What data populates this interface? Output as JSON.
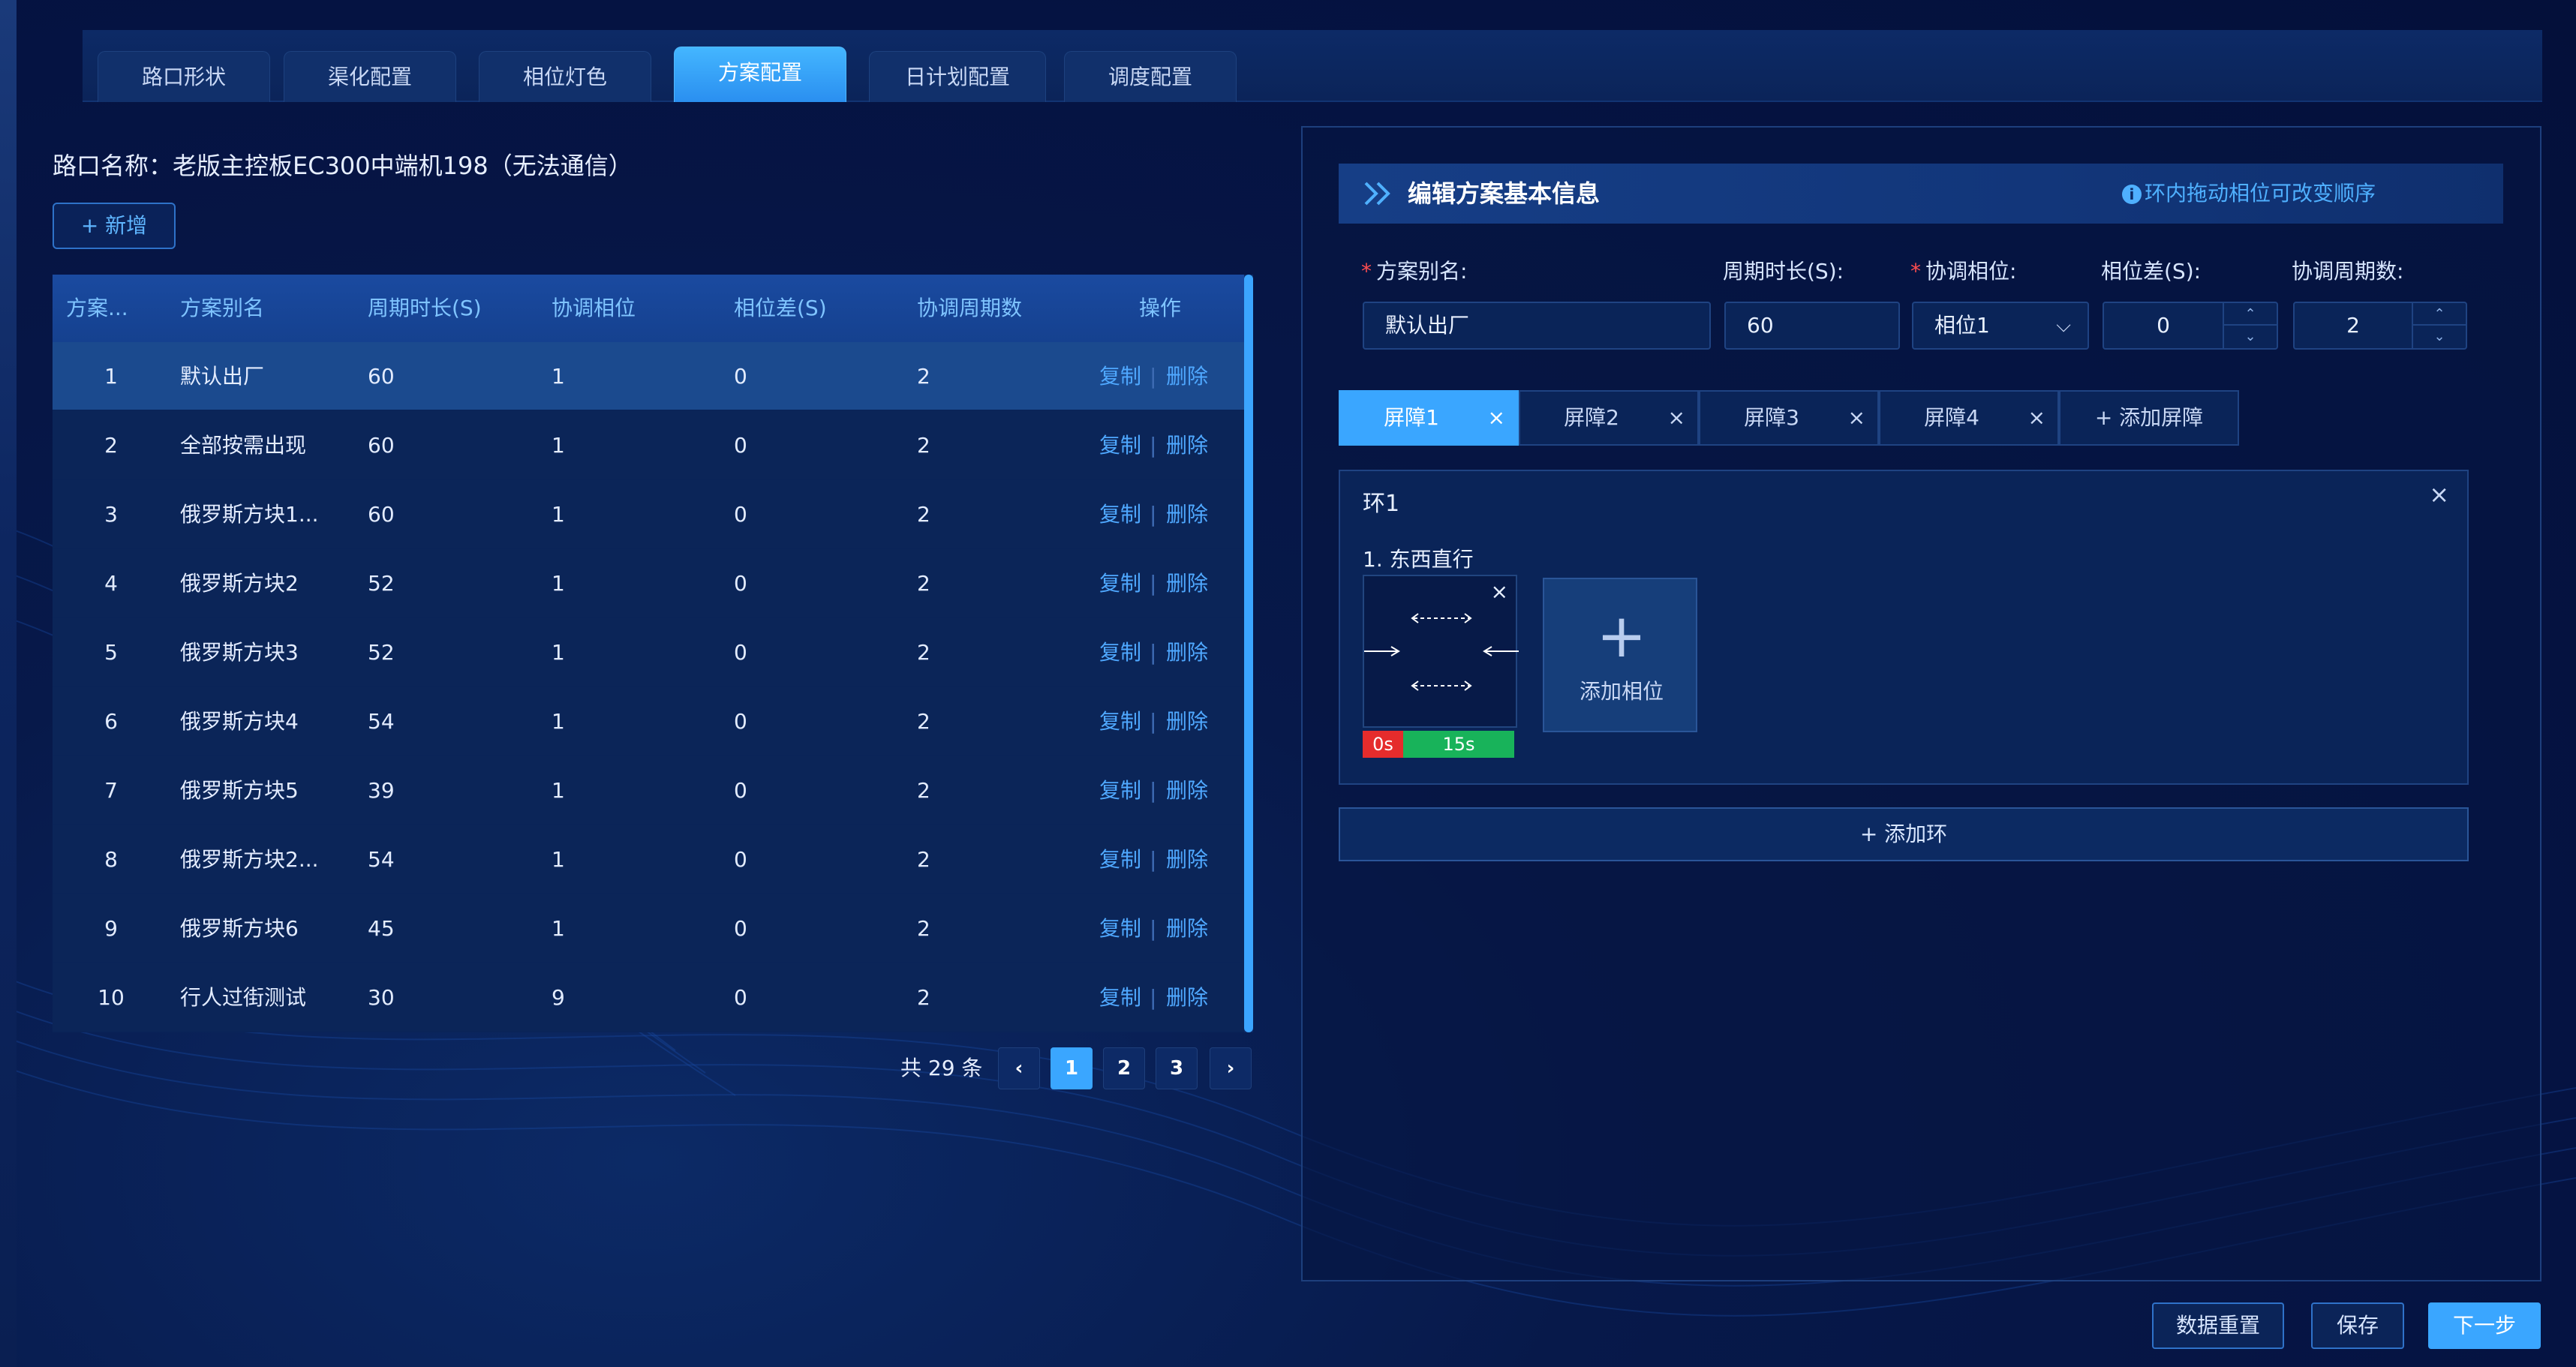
{
  "tabs": [
    {
      "label": "路口形状"
    },
    {
      "label": "渠化配置"
    },
    {
      "label": "相位灯色"
    },
    {
      "label": "方案配置"
    },
    {
      "label": "日计划配置"
    },
    {
      "label": "调度配置"
    }
  ],
  "active_tab": "方案配置",
  "intersection": {
    "title": "路口名称：老版主控板EC300中端机198（无法通信）"
  },
  "add_button": {
    "icon": "plus-icon",
    "label": "+ 新增"
  },
  "table": {
    "headers": [
      "方案...",
      "方案别名",
      "周期时长(S)",
      "协调相位",
      "相位差(S)",
      "协调周期数",
      "操作"
    ],
    "rows": [
      {
        "id": "1",
        "name": "默认出厂",
        "cycle": "60",
        "coord": "1",
        "offset": "0",
        "periods": "2",
        "copy": "复制",
        "sep": "|",
        "del": "删除"
      },
      {
        "id": "2",
        "name": "全部按需出现",
        "cycle": "60",
        "coord": "1",
        "offset": "0",
        "periods": "2",
        "copy": "复制",
        "sep": "|",
        "del": "删除"
      },
      {
        "id": "3",
        "name": "俄罗斯方块1...",
        "cycle": "60",
        "coord": "1",
        "offset": "0",
        "periods": "2",
        "copy": "复制",
        "sep": "|",
        "del": "删除"
      },
      {
        "id": "4",
        "name": "俄罗斯方块2",
        "cycle": "52",
        "coord": "1",
        "offset": "0",
        "periods": "2",
        "copy": "复制",
        "sep": "|",
        "del": "删除"
      },
      {
        "id": "5",
        "name": "俄罗斯方块3",
        "cycle": "52",
        "coord": "1",
        "offset": "0",
        "periods": "2",
        "copy": "复制",
        "sep": "|",
        "del": "删除"
      },
      {
        "id": "6",
        "name": "俄罗斯方块4",
        "cycle": "54",
        "coord": "1",
        "offset": "0",
        "periods": "2",
        "copy": "复制",
        "sep": "|",
        "del": "删除"
      },
      {
        "id": "7",
        "name": "俄罗斯方块5",
        "cycle": "39",
        "coord": "1",
        "offset": "0",
        "periods": "2",
        "copy": "复制",
        "sep": "|",
        "del": "删除"
      },
      {
        "id": "8",
        "name": "俄罗斯方块2...",
        "cycle": "54",
        "coord": "1",
        "offset": "0",
        "periods": "2",
        "copy": "复制",
        "sep": "|",
        "del": "删除"
      },
      {
        "id": "9",
        "name": "俄罗斯方块6",
        "cycle": "45",
        "coord": "1",
        "offset": "0",
        "periods": "2",
        "copy": "复制",
        "sep": "|",
        "del": "删除"
      },
      {
        "id": "10",
        "name": "行人过街测试",
        "cycle": "30",
        "coord": "9",
        "offset": "0",
        "periods": "2",
        "copy": "复制",
        "sep": "|",
        "del": "删除"
      }
    ]
  },
  "pagination": {
    "total": "共 29 条",
    "prev": "‹",
    "next": "›",
    "pages": [
      "1",
      "2",
      "3"
    ],
    "current": "1"
  },
  "editor": {
    "title": "编辑方案基本信息",
    "hint_icon": "i",
    "hint": "环内拖动相位可改变顺序",
    "fields": {
      "alias_label": "方案别名:",
      "alias_value": "默认出厂",
      "cycle_label": "周期时长(S):",
      "cycle_value": "60",
      "coord_label": "协调相位:",
      "coord_value": "相位1",
      "offset_label": "相位差(S):",
      "offset_value": "0",
      "periods_label": "协调周期数:",
      "periods_value": "2",
      "required_mark": "*",
      "chevron": "⌵",
      "up": "⌃",
      "down": "⌄"
    },
    "barriers": [
      {
        "label": "屏障1",
        "close": "×"
      },
      {
        "label": "屏障2",
        "close": "×"
      },
      {
        "label": "屏障3",
        "close": "×"
      },
      {
        "label": "屏障4",
        "close": "×"
      }
    ],
    "active_barrier": "屏障1",
    "add_barrier": "+ 添加屏障",
    "ring": {
      "title": "环1",
      "close": "×",
      "phase": {
        "name": "1. 东西直行",
        "close": "×",
        "red": "0s",
        "green": "15s",
        "icon": "east-west-straight-icon"
      },
      "add_phase": {
        "plus": "+",
        "label": "添加相位"
      }
    },
    "add_ring": "+ 添加环"
  },
  "footer": {
    "reset": "数据重置",
    "save": "保存",
    "next": "下一步"
  },
  "colors": {
    "accent": "#3aa6ff",
    "red": "#e52c2c",
    "green": "#18b35a",
    "background": "#051342"
  }
}
